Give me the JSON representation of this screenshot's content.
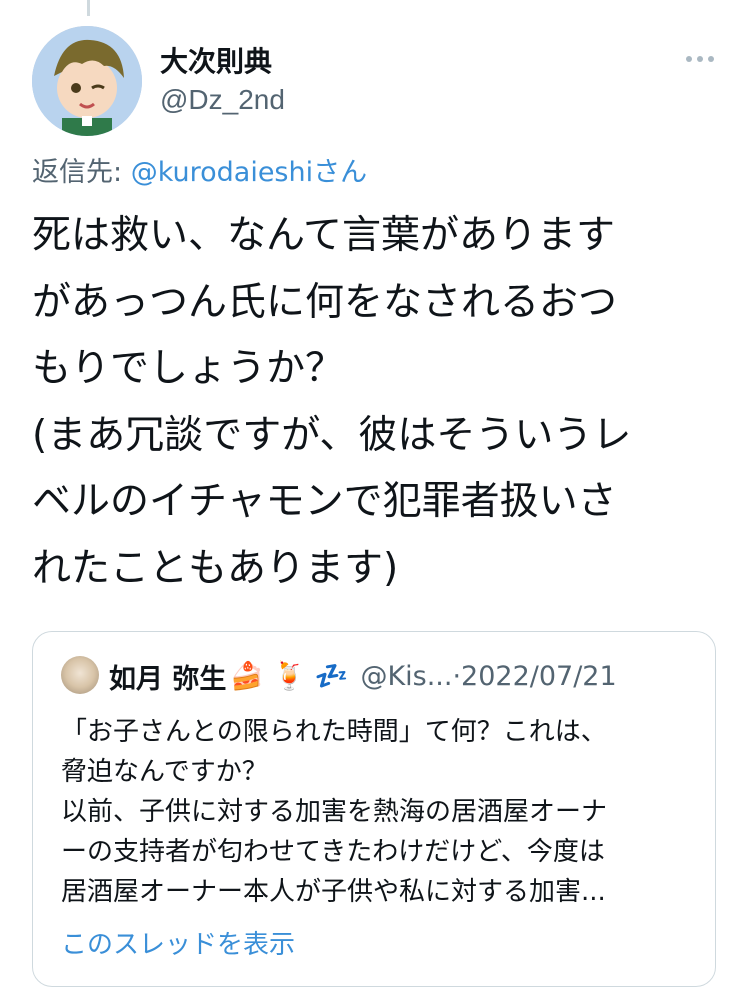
{
  "tweet": {
    "author_name": "大次則典",
    "author_handle": "@Dz_2nd",
    "reply_label": "返信先: ",
    "reply_mention": "@kurodaieshiさん",
    "text": "死は救い、なんて言葉があります\nがあっつん氏に何をなされるおつ\nもりでしょうか？\n(まあ冗談ですが、彼はそういうレ\nベルのイチャモンで犯罪者扱いさ\nれたこともあります)"
  },
  "quote": {
    "author_name": "如月 弥生",
    "name_emojis": "🍰 🍹 💤",
    "meta": "@Kis...·2022/07/21",
    "text": "「お子さんとの限られた時間」て何？これは、\n脅迫なんですか？\n以前、子供に対する加害を熱海の居酒屋オーナ\nーの支持者が匂わせてきたわけだけど、今度は\n居酒屋オーナー本人が子供や私に対する加害...",
    "show_thread": "このスレッドを表示"
  },
  "colors": {
    "link": "#3a8fd8",
    "secondary_text": "#536471",
    "border": "#cfd9de"
  },
  "icons": {
    "more": "more-horizontal-icon"
  }
}
